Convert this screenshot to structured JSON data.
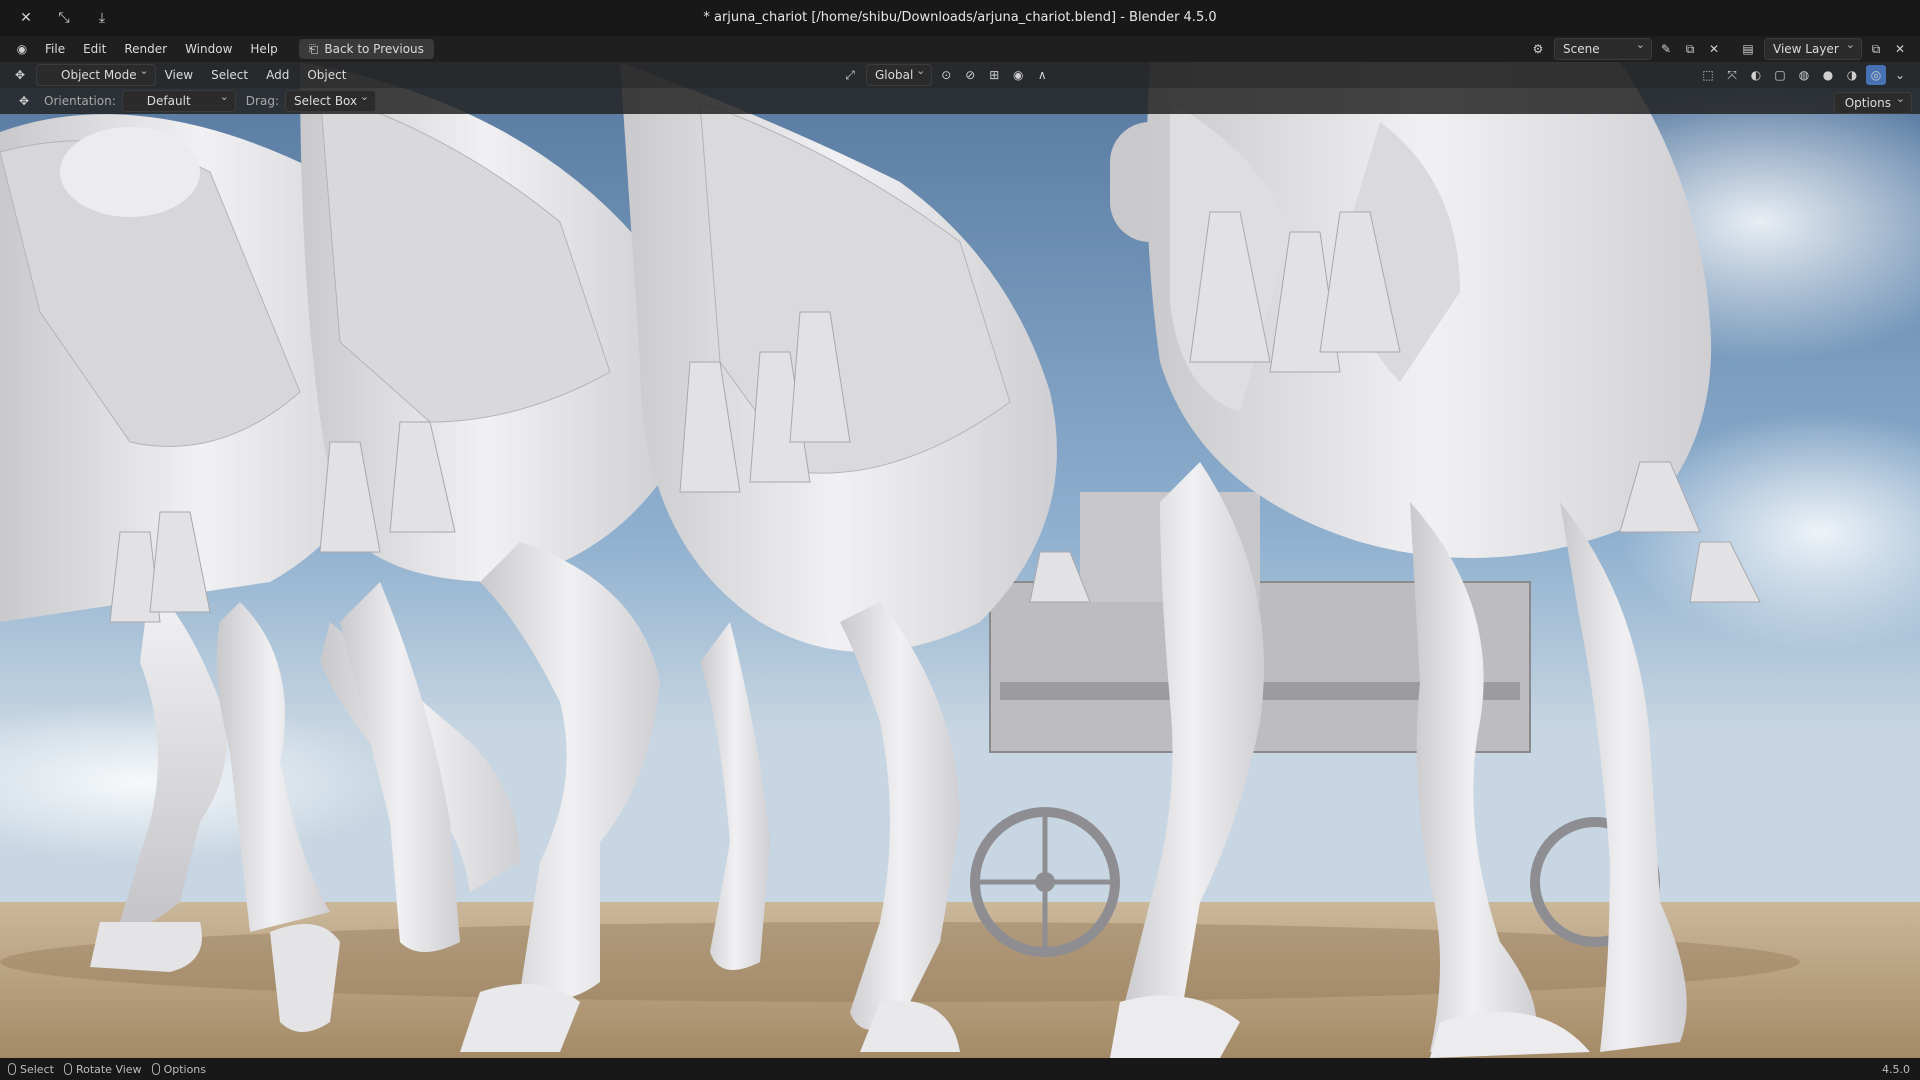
{
  "titlebar": {
    "title": "* arjuna_chariot [/home/shibu/Downloads/arjuna_chariot.blend] - Blender 4.5.0"
  },
  "menubar": {
    "items": [
      "File",
      "Edit",
      "Render",
      "Window",
      "Help"
    ],
    "back_button": "Back to Previous",
    "scene": "Scene",
    "view_layer": "View Layer"
  },
  "header": {
    "mode": "Object Mode",
    "menus": [
      "View",
      "Select",
      "Add",
      "Object"
    ],
    "transform_orientation": "Global"
  },
  "tool_settings": {
    "orientation_label": "Orientation:",
    "orientation_value": "Default",
    "drag_label": "Drag:",
    "drag_value": "Select Box",
    "options": "Options"
  },
  "statusbar": {
    "items": [
      "Select",
      "Rotate View",
      "Options"
    ],
    "version": "4.5.0"
  },
  "colors": {
    "ui_bg": "#1d1d1d",
    "sky_top": "#5f88b8",
    "sky_bottom": "#a9c4dd",
    "ground": "#b79f7e",
    "model": "#e8e8ea"
  }
}
